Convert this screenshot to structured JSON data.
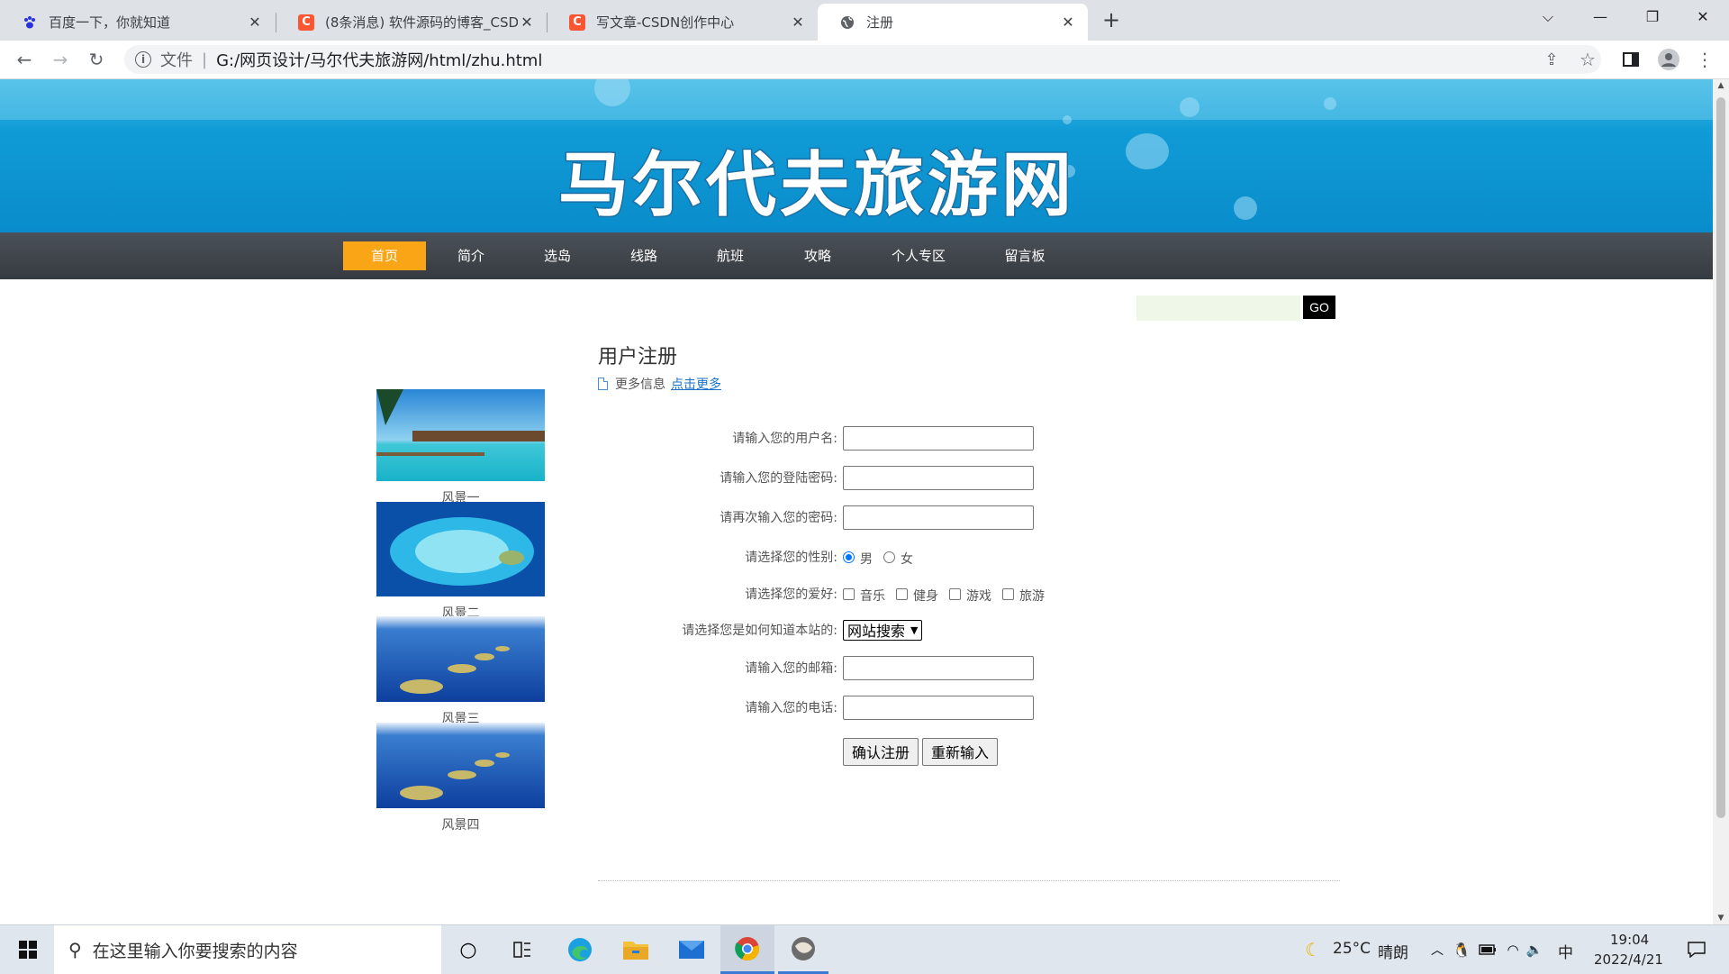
{
  "browser": {
    "tabs": [
      {
        "title": "百度一下，你就知道",
        "icon": "baidu-paw-icon"
      },
      {
        "title": "(8条消息) 软件源码的博客_CSDN",
        "icon": "csdn-icon"
      },
      {
        "title": "写文章-CSDN创作中心",
        "icon": "csdn-icon"
      },
      {
        "title": "注册",
        "icon": "globe-icon"
      }
    ],
    "address": {
      "label": "文件",
      "url": "G:/网页设计/马尔代夫旅游网/html/zhu.html"
    }
  },
  "site": {
    "title": "马尔代夫旅游网",
    "nav": [
      "首页",
      "简介",
      "选岛",
      "线路",
      "航班",
      "攻略",
      "个人专区",
      "留言板"
    ],
    "search": {
      "button": "GO",
      "value": ""
    },
    "scenery": [
      "风景一",
      "风景二",
      "风景三",
      "风景四"
    ]
  },
  "form": {
    "title": "用户注册",
    "more_text": "更多信息",
    "more_link": "点击更多",
    "username_label": "请输入您的用户名:",
    "password_label": "请输入您的登陆密码:",
    "confirm_label": "请再次输入您的密码:",
    "gender_label": "请选择您的性别:",
    "gender_options": [
      "男",
      "女"
    ],
    "gender_selected": "男",
    "hobby_label": "请选择您的爱好:",
    "hobbies": [
      "音乐",
      "健身",
      "游戏",
      "旅游"
    ],
    "source_label": "请选择您是如何知道本站的:",
    "source_selected": "网站搜索",
    "email_label": "请输入您的邮箱:",
    "phone_label": "请输入您的电话:",
    "submit": "确认注册",
    "reset": "重新输入"
  },
  "taskbar": {
    "search_placeholder": "在这里输入你要搜索的内容",
    "weather_temp": "25°C",
    "weather_text": "晴朗",
    "ime": "中",
    "time": "19:04",
    "date": "2022/4/21"
  },
  "colors": {
    "nav_active": "#f9a515",
    "banner": "#0f9bd6",
    "navbar": "#3e4349"
  }
}
